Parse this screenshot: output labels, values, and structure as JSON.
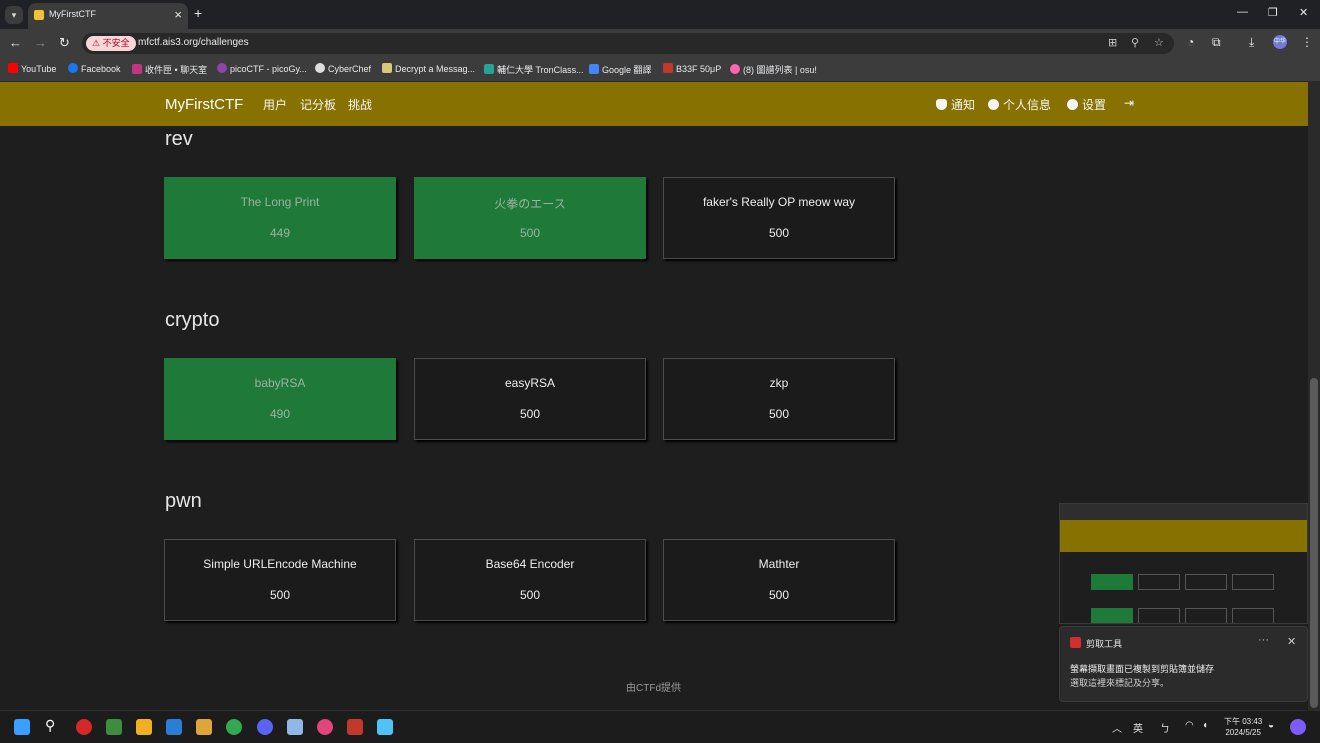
{
  "browser": {
    "tab_title": "MyFirstCTF",
    "insecure_label": "不安全",
    "url": "mfctf.ais3.org/challenges",
    "profile_label": "中华",
    "bookmarks": [
      {
        "label": "YouTube",
        "color": "#ff0000"
      },
      {
        "label": "Facebook",
        "color": "#1877f2"
      },
      {
        "label": "收件匣 • 聊天室",
        "color": "#c13584"
      },
      {
        "label": "picoCTF - picoGy...",
        "color": "#8e44ad"
      },
      {
        "label": "CyberChef",
        "color": "#dddddd"
      },
      {
        "label": "Decrypt a Messag...",
        "color": "#d9c77a"
      },
      {
        "label": "輔仁大學 TronClass...",
        "color": "#2aa198"
      },
      {
        "label": "Google 翻譯",
        "color": "#4285f4"
      },
      {
        "label": "B33F 50μP",
        "color": "#c0392b"
      },
      {
        "label": "(8) 圖譜列表 | osu!",
        "color": "#ff66aa"
      }
    ]
  },
  "site": {
    "brand": "MyFirstCTF",
    "nav": [
      "用户",
      "记分板",
      "挑战"
    ],
    "nav_right": [
      "通知",
      "个人信息",
      "设置"
    ],
    "footer": "由CTFd提供"
  },
  "categories": [
    {
      "name": "rev",
      "challenges": [
        {
          "name": "The Long Print",
          "points": "449",
          "solved": true
        },
        {
          "name": "火拳のエース",
          "points": "500",
          "solved": true
        },
        {
          "name": "faker's Really OP meow way",
          "points": "500",
          "solved": false
        }
      ]
    },
    {
      "name": "crypto",
      "challenges": [
        {
          "name": "babyRSA",
          "points": "490",
          "solved": true
        },
        {
          "name": "easyRSA",
          "points": "500",
          "solved": false
        },
        {
          "name": "zkp",
          "points": "500",
          "solved": false
        }
      ]
    },
    {
      "name": "pwn",
      "challenges": [
        {
          "name": "Simple URLEncode Machine",
          "points": "500",
          "solved": false
        },
        {
          "name": "Base64 Encoder",
          "points": "500",
          "solved": false
        },
        {
          "name": "Mathter",
          "points": "500",
          "solved": false
        }
      ]
    }
  ],
  "toast": {
    "app": "剪取工具",
    "title": "螢幕擷取畫面已複製到剪貼簿並儲存",
    "subtitle": "選取這裡來標記及分享。"
  },
  "taskbar": {
    "ime": "英",
    "time": "下午 03:43",
    "date": "2024/5/25"
  }
}
